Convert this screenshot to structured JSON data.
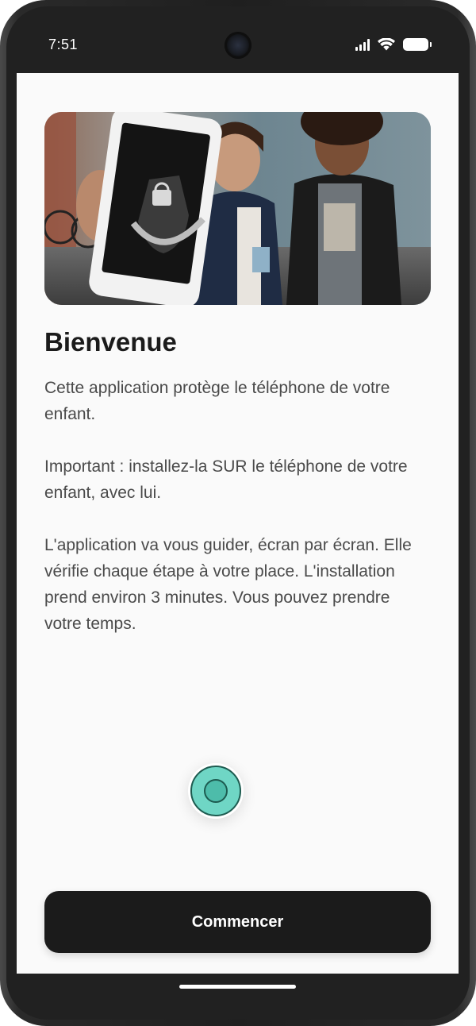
{
  "status_bar": {
    "time": "7:51",
    "icons": [
      "signal-icon",
      "wifi-icon",
      "battery-icon"
    ]
  },
  "hero": {
    "image": "two-children-holding-phone-with-shield-lock-logo"
  },
  "welcome": {
    "title": "Bienvenue",
    "paragraphs": [
      "Cette application protège le téléphone de votre enfant.",
      "Important : installez-la SUR le téléphone de votre enfant, avec lui.",
      "L'application va vous guider, écran par écran. Elle vérifie chaque étape à votre place. L'installation prend environ 3 minutes. Vous pouvez prendre votre temps."
    ]
  },
  "assistant": {
    "icon": "assistant-orb-icon",
    "color": "#6fd6c5"
  },
  "actions": {
    "start_label": "Commencer"
  },
  "colors": {
    "primary_button": "#1b1b1b",
    "screen_background": "#fafafa",
    "accent": "#6fd6c5"
  }
}
